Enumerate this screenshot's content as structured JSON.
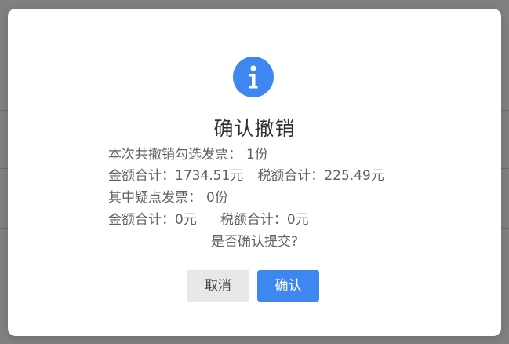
{
  "dialog": {
    "title": "确认撤销",
    "summary": {
      "count_label": "本次共撤销勾选发票：",
      "count_value": "1份",
      "amount_label": "金额合计：",
      "amount_value": "1734.51元",
      "tax_label": "税额合计：",
      "tax_value": "225.49元"
    },
    "suspicious": {
      "count_label": "其中疑点发票：",
      "count_value": "0份",
      "amount_label": "金额合计：",
      "amount_value": "0元",
      "tax_label": "税额合计：",
      "tax_value": "0元"
    },
    "question": "是否确认提交?",
    "cancel_label": "取消",
    "confirm_label": "确认"
  },
  "colors": {
    "accent": "#3f87f0",
    "overlay": "#808080",
    "cancel_bg": "#e6e8ea"
  },
  "icons": {
    "dialog_icon": "info-circle-icon"
  }
}
